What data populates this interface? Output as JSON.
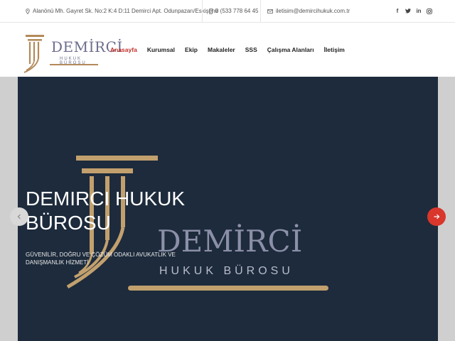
{
  "topbar": {
    "address": "Alanönü Mh. Gayret Sk. No:2 K:4 D:11 Demirci Apt. Odunpazarı/Eskişehir",
    "phone": "0 (533 778 64 45",
    "email": "iletisim@demircihukuk.com.tr",
    "social": [
      "facebook-icon",
      "twitter-icon",
      "linkedin-icon",
      "instagram-icon"
    ]
  },
  "logo": {
    "name": "DEMİRCİ",
    "subtitle": "HUKUK BÜROSU"
  },
  "nav": {
    "items": [
      "Anasayfa",
      "Kurumsal",
      "Ekip",
      "Makaleler",
      "SSS",
      "Çalışma Alanları",
      "İletişim"
    ],
    "active": "Anasayfa"
  },
  "hero": {
    "title": "DEMIRCI HUKUK BÜROSU",
    "subtitle": "GÜVENİLİR, DOĞRU VE ÇÖZÜM ODAKLI AVUKATLIK VE DANIŞMANLIK HİZMETİ",
    "watermark_name": "DEMİRCİ",
    "watermark_sub": "HUKUK BÜROSU"
  },
  "colors": {
    "accent": "#c3312a",
    "gold": "#b38a5a",
    "navy": "#1d2b3c",
    "logo_text": "#6c6e8d"
  }
}
